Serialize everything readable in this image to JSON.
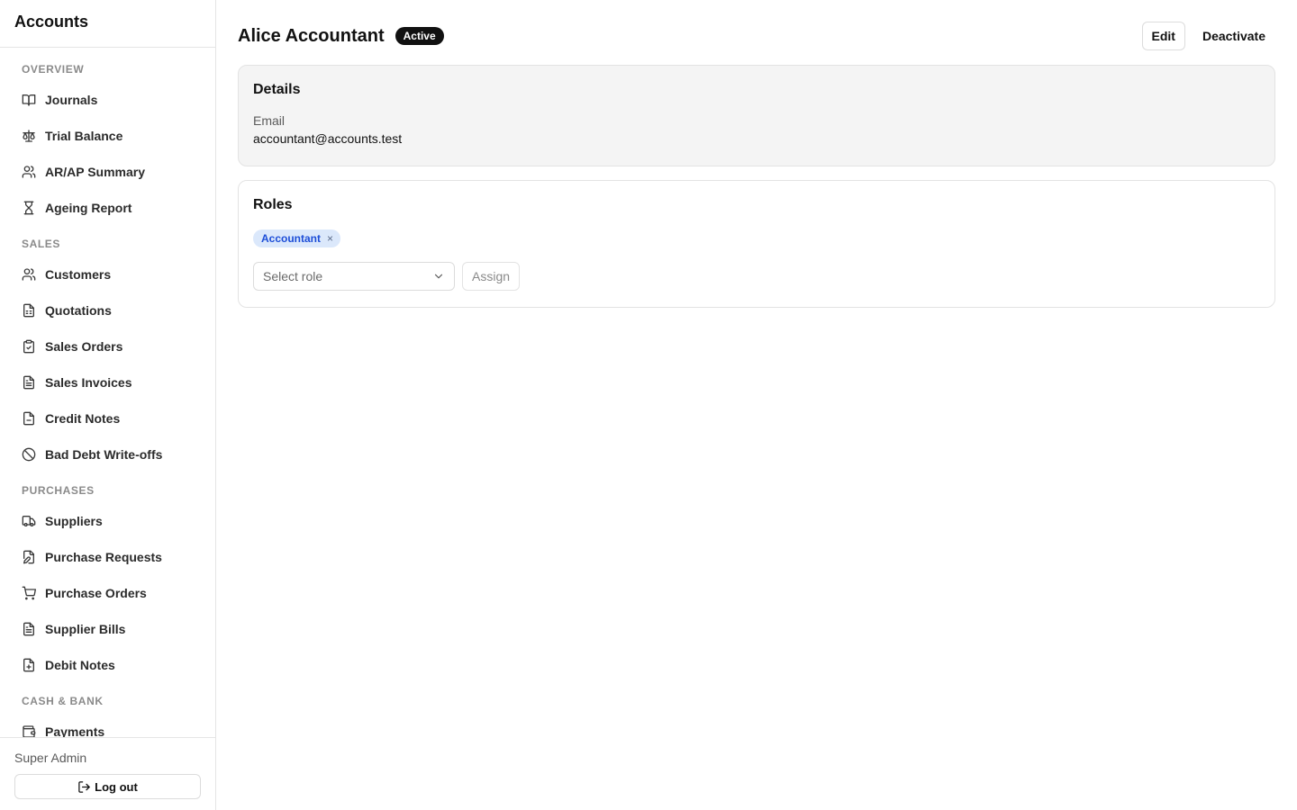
{
  "sidebar": {
    "brand": "Accounts",
    "sections": [
      {
        "title": "OVERVIEW",
        "items": [
          {
            "label": "Journals",
            "icon": "book-open-icon"
          },
          {
            "label": "Trial Balance",
            "icon": "scale-icon"
          },
          {
            "label": "AR/AP Summary",
            "icon": "users-icon"
          },
          {
            "label": "Ageing Report",
            "icon": "hourglass-icon"
          }
        ]
      },
      {
        "title": "SALES",
        "items": [
          {
            "label": "Customers",
            "icon": "users-icon"
          },
          {
            "label": "Quotations",
            "icon": "file-spreadsheet-icon"
          },
          {
            "label": "Sales Orders",
            "icon": "clipboard-check-icon"
          },
          {
            "label": "Sales Invoices",
            "icon": "file-text-icon"
          },
          {
            "label": "Credit Notes",
            "icon": "file-minus-icon"
          },
          {
            "label": "Bad Debt Write-offs",
            "icon": "ban-icon"
          }
        ]
      },
      {
        "title": "PURCHASES",
        "items": [
          {
            "label": "Suppliers",
            "icon": "truck-icon"
          },
          {
            "label": "Purchase Requests",
            "icon": "file-pen-icon"
          },
          {
            "label": "Purchase Orders",
            "icon": "shopping-cart-icon"
          },
          {
            "label": "Supplier Bills",
            "icon": "file-text-icon"
          },
          {
            "label": "Debit Notes",
            "icon": "file-plus-icon"
          }
        ]
      },
      {
        "title": "CASH & BANK",
        "items": [
          {
            "label": "Payments",
            "icon": "wallet-icon"
          }
        ]
      }
    ],
    "footer": {
      "user_name": "Super Admin",
      "logout_label": "Log out"
    }
  },
  "main": {
    "title": "Alice Accountant",
    "status": "Active",
    "actions": {
      "edit_label": "Edit",
      "deactivate_label": "Deactivate"
    },
    "details": {
      "title": "Details",
      "email_label": "Email",
      "email_value": "accountant@accounts.test"
    },
    "roles": {
      "title": "Roles",
      "assigned": [
        "Accountant"
      ],
      "remove_glyph": "×",
      "select_placeholder": "Select role",
      "assign_label": "Assign"
    }
  },
  "colors": {
    "badge_bg": "#111111",
    "chip_bg": "#dbe8fb",
    "chip_text": "#1d4ed8",
    "details_bg": "#f4f4f4"
  }
}
